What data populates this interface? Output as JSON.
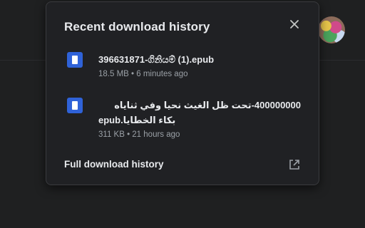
{
  "panel": {
    "title": "Recent download history",
    "close_icon": "close-icon",
    "items": [
      {
        "icon": "document-icon",
        "name": "396631871-ගිනියම් (1).epub",
        "meta": "18.5 MB • 6 minutes ago"
      },
      {
        "icon": "document-icon",
        "name_line1": "400000000-تحت ظل الغيث نحيا وفي ثناياه",
        "name_line2": "بكاء الخطايا.epub",
        "meta": "311 KB • 21 hours ago"
      }
    ],
    "footer_link": "Full download history",
    "footer_icon": "open-in-new-icon"
  },
  "colors": {
    "background": "#1f2021",
    "panel": "#202124",
    "text": "#e8eaed",
    "muted": "#9aa0a6",
    "file_icon": "#2f62d8"
  }
}
